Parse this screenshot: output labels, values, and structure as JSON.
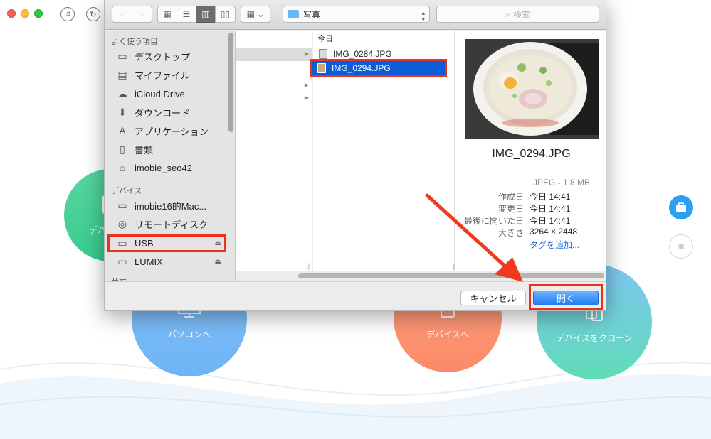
{
  "app": {
    "circles": [
      {
        "label": "デバイスへ"
      },
      {
        "label": "パソコンへ"
      },
      {
        "label": "デバイスへ"
      },
      {
        "label": "デバイスをクローン"
      }
    ],
    "side_buttons": [
      "toolbox-icon",
      "grid-icon"
    ]
  },
  "dialog": {
    "toolbar": {
      "location": "写真",
      "search_placeholder": "検索"
    },
    "sidebar": {
      "favorites_title": "よく使う項目",
      "favorites": [
        {
          "label": "デスクトップ",
          "icon": "desktop-icon"
        },
        {
          "label": "マイファイル",
          "icon": "my-files-icon"
        },
        {
          "label": "iCloud Drive",
          "icon": "cloud-icon"
        },
        {
          "label": "ダウンロード",
          "icon": "download-icon"
        },
        {
          "label": "アプリケーション",
          "icon": "applications-icon"
        },
        {
          "label": "書類",
          "icon": "documents-icon"
        },
        {
          "label": "imobie_seo42",
          "icon": "home-icon"
        }
      ],
      "devices_title": "デバイス",
      "devices": [
        {
          "label": "imobie16的Mac...",
          "icon": "hard-drive-icon"
        },
        {
          "label": "リモートディスク",
          "icon": "disc-icon"
        },
        {
          "label": "USB",
          "icon": "usb-drive-icon",
          "selected": true
        },
        {
          "label": "LUMIX",
          "icon": "usb-drive-icon"
        }
      ],
      "shared_title": "共有"
    },
    "files_header": "今日",
    "files": [
      {
        "name": "IMG_0284.JPG",
        "selected": false
      },
      {
        "name": "IMG_0294.JPG",
        "selected": true
      }
    ],
    "preview": {
      "name": "IMG_0294.JPG",
      "type": "JPEG - 1.8 MB",
      "meta": [
        {
          "label": "作成日",
          "value": "今日 14:41"
        },
        {
          "label": "変更日",
          "value": "今日 14:41"
        },
        {
          "label": "最後に開いた日",
          "value": "今日 14:41"
        },
        {
          "label": "大きさ",
          "value": "3264 × 2448"
        }
      ],
      "add_tags": "タグを追加..."
    },
    "buttons": {
      "cancel": "キャンセル",
      "open": "開く"
    }
  },
  "colors": {
    "highlight": "#e8321e",
    "selection": "#0b5cd7",
    "primary_button": "#1e7cf2"
  }
}
